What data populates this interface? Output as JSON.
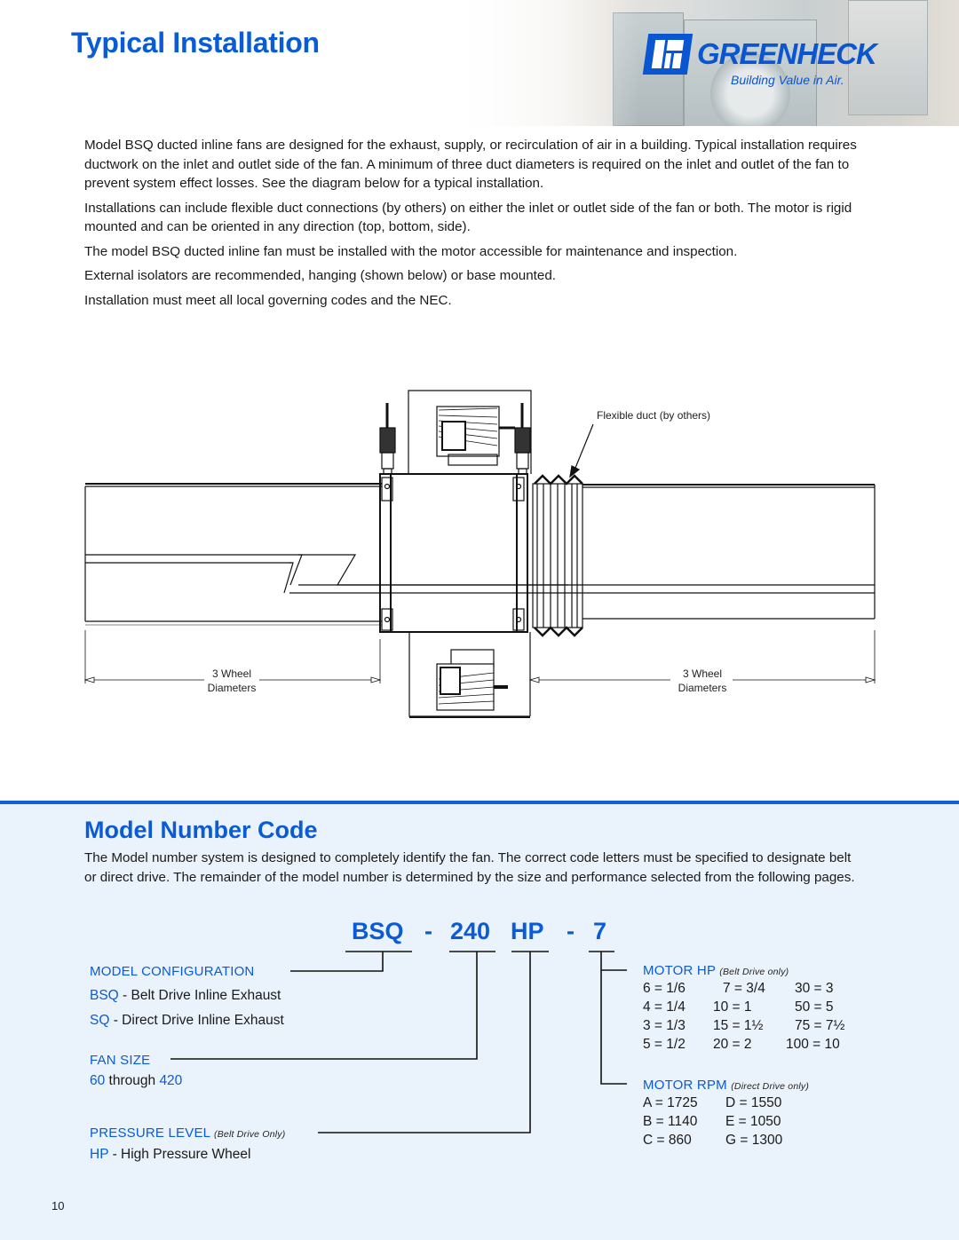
{
  "page": {
    "title": "Typical Installation",
    "page_number": "10"
  },
  "brand": {
    "name": "GREENHECK",
    "tagline": "Building Value in Air.",
    "color": "#0a55d0"
  },
  "intro": {
    "paragraphs": [
      "Model BSQ ducted inline fans are designed for the exhaust, supply, or recirculation of air in a building. Typical installation requires ductwork on the inlet and outlet side of the fan. A minimum of three duct diameters is required on the inlet and outlet of the fan to prevent system effect losses. See the diagram below for a typical installation.",
      "Installations can include flexible duct connections (by others) on either the inlet or outlet side of the fan or both. The motor is rigid mounted and can be oriented in any direction (top, bottom, side).",
      "The model BSQ ducted inline fan must be installed with the motor accessible for maintenance and inspection.",
      "External isolators are recommended, hanging (shown below) or base mounted.",
      "Installation must meet all local governing codes and the NEC."
    ]
  },
  "diagram": {
    "flex_duct_label": "Flexible duct (by others)",
    "left_dimension": {
      "line1": "3 Wheel",
      "line2": "Diameters"
    },
    "right_dimension": {
      "line1": "3 Wheel",
      "line2": "Diameters"
    }
  },
  "model_code": {
    "title": "Model Number Code",
    "description": "The Model number system is designed to completely identify the fan. The correct code letters must be specified to designate belt or direct drive. The remainder of the model number is determined by the size and performance selected from the following pages.",
    "example": {
      "config": "BSQ",
      "sep1": "-",
      "size": "240",
      "pressure": "HP",
      "sep2": "-",
      "motor": "7"
    },
    "model_configuration": {
      "label": "MODEL CONFIGURATION",
      "options": [
        {
          "code": "BSQ",
          "desc": " - Belt Drive Inline Exhaust"
        },
        {
          "code": "SQ",
          "desc": " - Direct Drive Inline Exhaust"
        }
      ]
    },
    "fan_size": {
      "label": "FAN SIZE",
      "min": "60",
      "through": " through ",
      "max": "420"
    },
    "pressure_level": {
      "label": "PRESSURE LEVEL",
      "note": "(Belt Drive Only)",
      "options": [
        {
          "code": "HP",
          "desc": " - High Pressure Wheel"
        }
      ]
    },
    "motor_hp": {
      "label": "MOTOR HP",
      "note": "(Belt Drive only)",
      "rows": [
        [
          "6 = 1/6",
          "7 = 3/4",
          "30 = 3"
        ],
        [
          "4 = 1/4",
          "10 = 1",
          "50 = 5"
        ],
        [
          "3 = 1/3",
          "15 = 1½",
          "75 = 7½"
        ],
        [
          "5 = 1/2",
          "20 = 2",
          "100 = 10"
        ]
      ]
    },
    "motor_rpm": {
      "label": "MOTOR RPM",
      "note": "(Direct Drive only)",
      "rows": [
        [
          "A = 1725",
          "D = 1550"
        ],
        [
          "B = 1140",
          "E = 1050"
        ],
        [
          "C = 860",
          "G = 1300"
        ]
      ]
    }
  },
  "colors": {
    "accent_blue": "#0a5bd6",
    "section_bg": "#eaf2fb"
  }
}
